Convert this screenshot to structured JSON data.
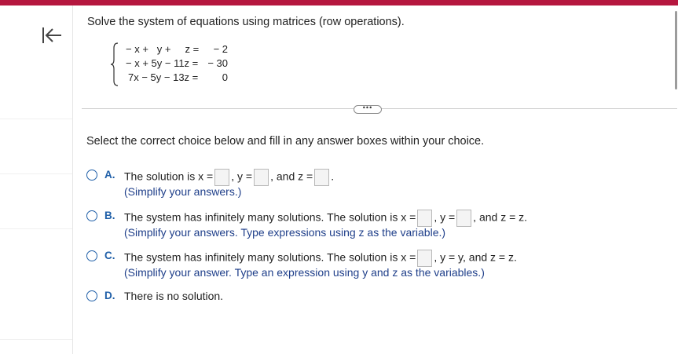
{
  "header": {
    "accent_color": "#b5173f"
  },
  "question": {
    "prompt": "Solve the system of equations using matrices (row operations).",
    "equations": [
      {
        "lhs": "− x +   y +     z =",
        "rhs": "− 2"
      },
      {
        "lhs": "− x + 5y − 11z =",
        "rhs": "− 30"
      },
      {
        "lhs": "7x − 5y − 13z =",
        "rhs": "0"
      }
    ]
  },
  "more_button": {
    "label": "•••"
  },
  "instruction": "Select the correct choice below and fill in any answer boxes within your choice.",
  "choices": [
    {
      "letter": "A.",
      "parts": [
        "The solution is x =",
        ", y =",
        ", and z =",
        "."
      ],
      "hint": "(Simplify your answers.)"
    },
    {
      "letter": "B.",
      "parts": [
        "The system has infinitely many solutions. The solution is x =",
        ", y =",
        ", and z = z."
      ],
      "hint": "(Simplify your answers. Type expressions using z as the variable.)"
    },
    {
      "letter": "C.",
      "parts": [
        "The system has infinitely many solutions. The solution is x =",
        ", y = y, and z = z."
      ],
      "hint": "(Simplify your answer. Type an expression using y and z as the variables.)"
    },
    {
      "letter": "D.",
      "parts": [
        "There is no solution."
      ]
    }
  ]
}
